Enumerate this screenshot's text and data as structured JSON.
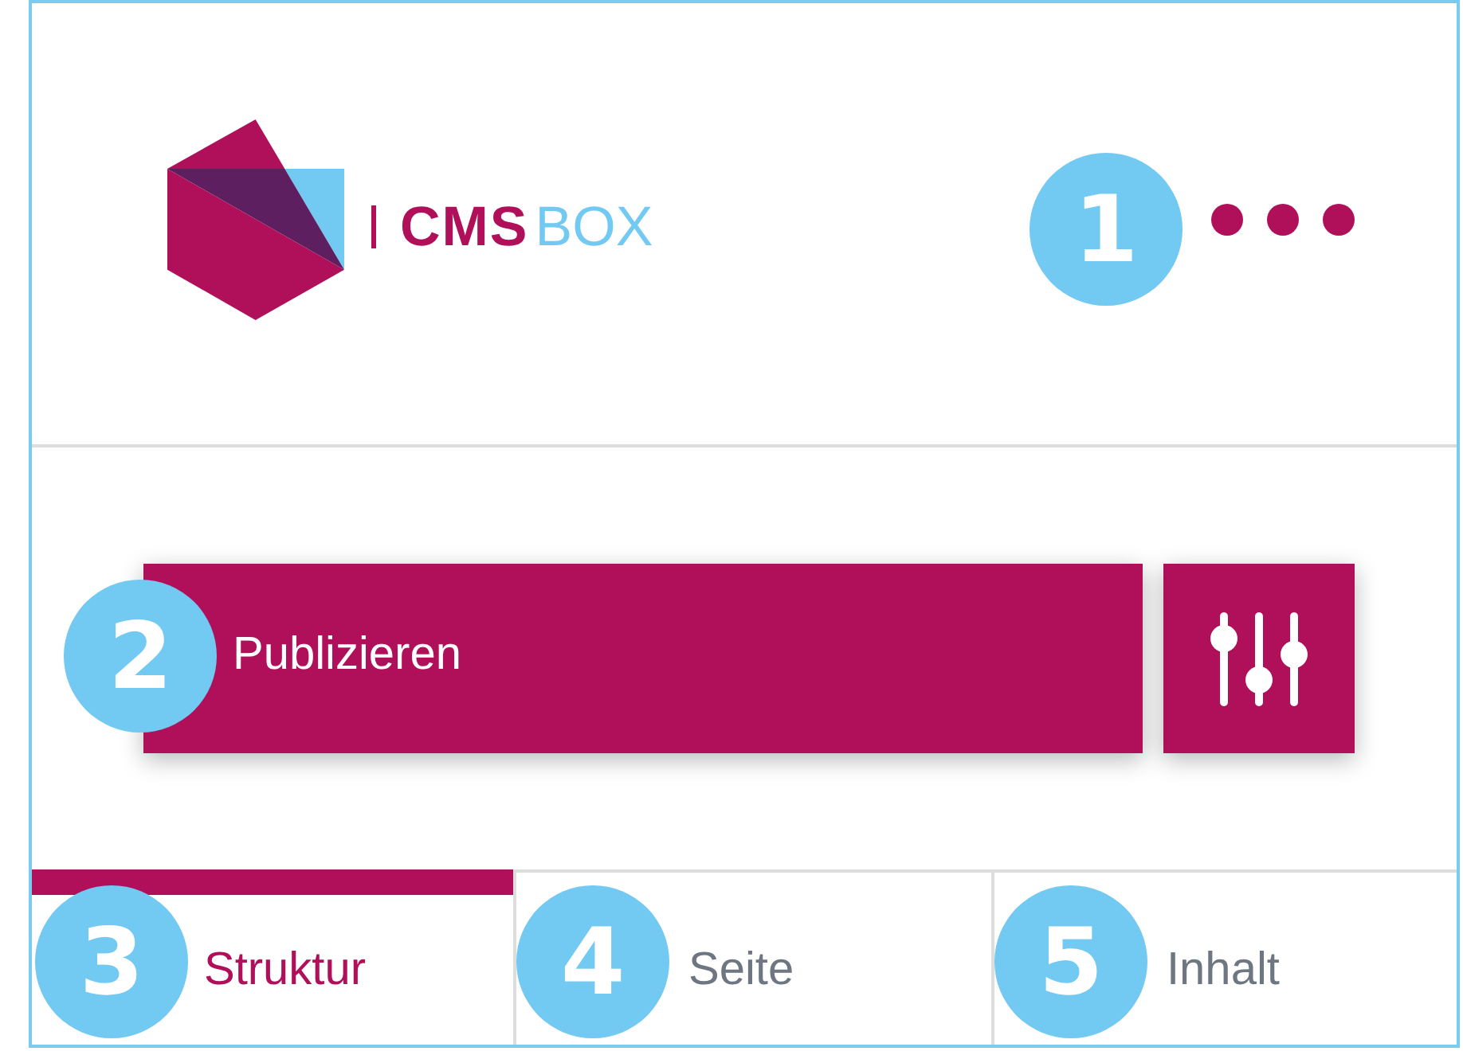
{
  "header": {
    "logo": {
      "primary": "CMS",
      "secondary": "BOX"
    },
    "menu_button": {
      "callout": "1"
    }
  },
  "publish": {
    "button": {
      "label": "Publizieren",
      "callout": "2"
    }
  },
  "tabs": [
    {
      "label": "Struktur",
      "selected": true,
      "callout": "3"
    },
    {
      "label": "Seite",
      "selected": false,
      "callout": "4"
    },
    {
      "label": "Inhalt",
      "selected": false,
      "callout": "5"
    }
  ]
}
